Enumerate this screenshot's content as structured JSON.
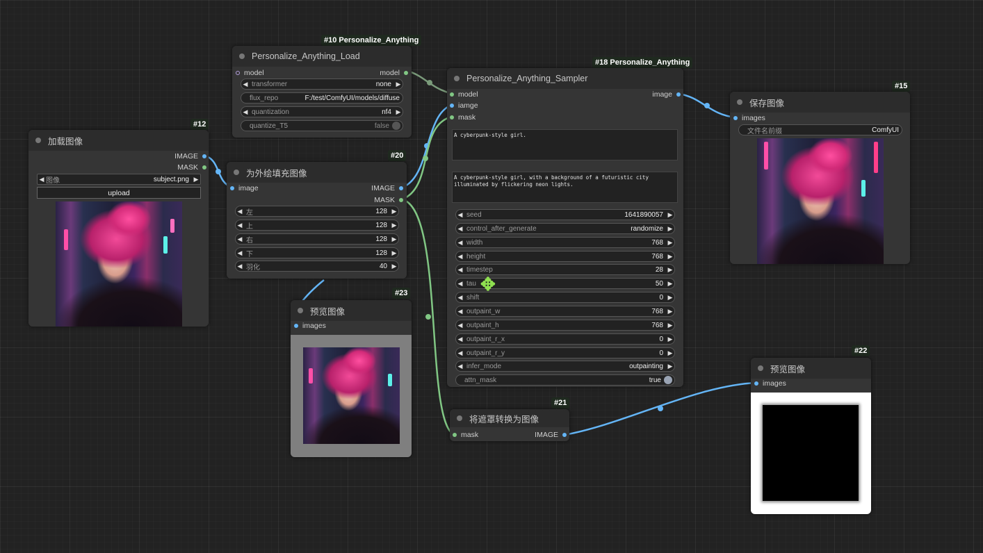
{
  "colors": {
    "image": "#64b5f6",
    "mask": "#81c784",
    "model": "#b39ddb",
    "link_model": "#7a9a7a"
  },
  "nodes": {
    "load_model": {
      "badge": "#10 Personalize_Anything",
      "title": "Personalize_Anything_Load",
      "in_model": "model",
      "out_model": "model",
      "widgets": [
        {
          "label": "transformer",
          "value": "none"
        },
        {
          "label": "flux_repo",
          "value": "F:/test/ComfyUI/models/diffuse"
        },
        {
          "label": "quantization",
          "value": "nf4"
        },
        {
          "label": "quantize_T5",
          "value": "false"
        }
      ]
    },
    "load_image": {
      "badge": "#12",
      "title": "加载图像",
      "out_image": "IMAGE",
      "out_mask": "MASK",
      "widget_label": "图像",
      "widget_value": "subject.png",
      "upload": "upload"
    },
    "pad": {
      "badge": "#20",
      "title": "为外绘填充图像",
      "in_image": "image",
      "out_image": "IMAGE",
      "out_mask": "MASK",
      "widgets": [
        {
          "label": "左",
          "value": "128"
        },
        {
          "label": "上",
          "value": "128"
        },
        {
          "label": "右",
          "value": "128"
        },
        {
          "label": "下",
          "value": "128"
        },
        {
          "label": "羽化",
          "value": "40"
        }
      ]
    },
    "preview23": {
      "badge": "#23",
      "title": "预览图像",
      "in_images": "images"
    },
    "sampler": {
      "badge": "#18 Personalize_Anything",
      "title": "Personalize_Anything_Sampler",
      "in_model": "model",
      "in_iamge": "iamge",
      "in_mask": "mask",
      "out_image": "image",
      "prompt1": "A cyberpunk-style girl.",
      "prompt2": "A cyberpunk-style girl, with a background of a futuristic city illuminated by flickering neon lights.",
      "widgets": [
        {
          "label": "seed",
          "value": "1641890057"
        },
        {
          "label": "control_after_generate",
          "value": "randomize"
        },
        {
          "label": "width",
          "value": "768"
        },
        {
          "label": "height",
          "value": "768"
        },
        {
          "label": "timestep",
          "value": "28"
        },
        {
          "label": "tau",
          "value": "50"
        },
        {
          "label": "shift",
          "value": "0"
        },
        {
          "label": "outpaint_w",
          "value": "768"
        },
        {
          "label": "outpaint_h",
          "value": "768"
        },
        {
          "label": "outpaint_r_x",
          "value": "0"
        },
        {
          "label": "outpaint_r_y",
          "value": "0"
        },
        {
          "label": "infer_mode",
          "value": "outpainting"
        },
        {
          "label": "attn_mask",
          "value": "true"
        }
      ]
    },
    "save": {
      "badge": "#15",
      "title": "保存图像",
      "in_images": "images",
      "widget_label": "文件名前缀",
      "widget_value": "ComfyUI"
    },
    "mask2image": {
      "badge": "#21",
      "title": "将遮罩转换为图像",
      "in_mask": "mask",
      "out_image": "IMAGE"
    },
    "preview22": {
      "badge": "#22",
      "title": "预览图像",
      "in_images": "images"
    }
  }
}
